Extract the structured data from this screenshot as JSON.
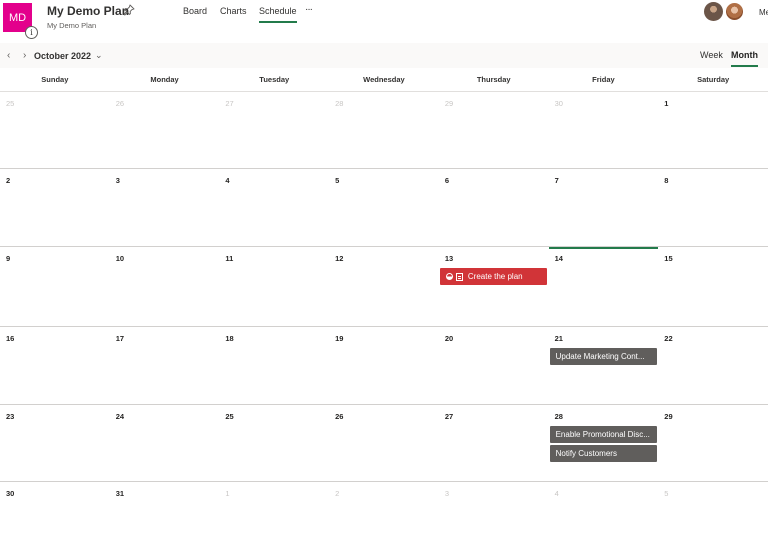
{
  "header": {
    "avatar_initials": "MD",
    "avatar_color": "#e3008c",
    "info_glyph": "i",
    "title": "My Demo Plan",
    "subtitle": "My Demo Plan",
    "tabs": [
      {
        "label": "Board",
        "active": false
      },
      {
        "label": "Charts",
        "active": false
      },
      {
        "label": "Schedule",
        "active": true
      }
    ],
    "more_label": "···",
    "user_label": "Me",
    "accent_color": "#237b4b"
  },
  "toolbar": {
    "prev_icon": "‹",
    "next_icon": "›",
    "month": "October 2022",
    "month_chevron": "⌄",
    "views": [
      "Week",
      "Month"
    ],
    "active_view": "Month"
  },
  "calendar": {
    "weekdays": [
      "Sunday",
      "Monday",
      "Tuesday",
      "Wednesday",
      "Thursday",
      "Friday",
      "Saturday"
    ],
    "weeks": [
      [
        "25",
        "26",
        "27",
        "28",
        "29",
        "30",
        "1"
      ],
      [
        "2",
        "3",
        "4",
        "5",
        "6",
        "7",
        "8"
      ],
      [
        "9",
        "10",
        "11",
        "12",
        "13",
        "14",
        "15"
      ],
      [
        "16",
        "17",
        "18",
        "19",
        "20",
        "21",
        "22"
      ],
      [
        "23",
        "24",
        "25",
        "26",
        "27",
        "28",
        "29"
      ],
      [
        "30",
        "31",
        "1",
        "2",
        "3",
        "4",
        "5"
      ]
    ],
    "today": "14",
    "tasks": [
      {
        "title": "Create the plan",
        "date": "13",
        "color": "#d13438",
        "in_progress": true,
        "has_notes": true
      },
      {
        "title": "Update Marketing Cont...",
        "date": "21",
        "color": "#605e5c"
      },
      {
        "title": "Enable Promotional Disc...",
        "date": "28",
        "color": "#605e5c"
      },
      {
        "title": "Notify Customers",
        "date": "28",
        "color": "#605e5c"
      }
    ]
  }
}
